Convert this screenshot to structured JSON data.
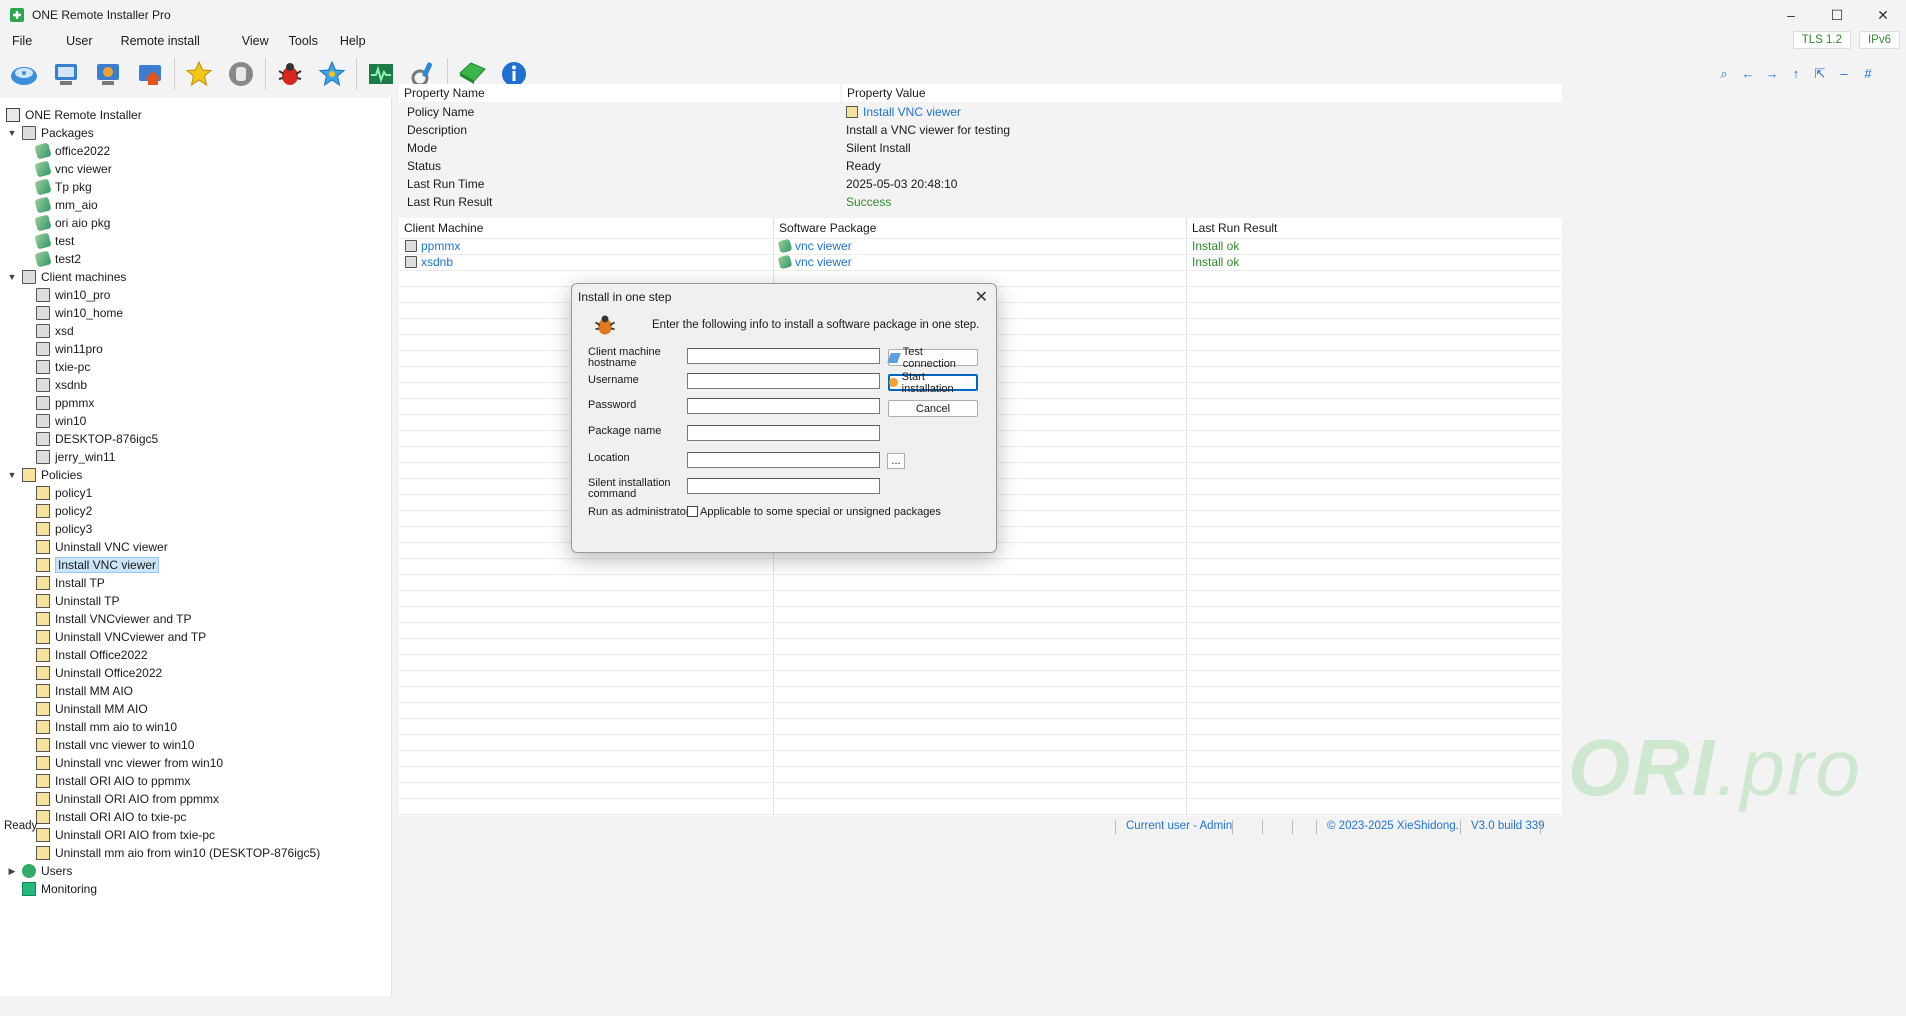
{
  "window": {
    "title": "ONE Remote Installer Pro",
    "min": "–",
    "max": "☐",
    "close": "✕"
  },
  "menu": [
    "File",
    "User",
    "Remote install",
    "View",
    "Tools",
    "Help"
  ],
  "badges": {
    "tls": "TLS 1.2",
    "ip": "IPv6"
  },
  "right_tools": [
    "⌕",
    "←",
    "→",
    "↑",
    "⇱",
    "–",
    "#"
  ],
  "tree": {
    "root": "ONE Remote Installer",
    "packages_label": "Packages",
    "packages": [
      "office2022",
      "vnc viewer",
      "Tp pkg",
      "mm_aio",
      "ori aio pkg",
      "test",
      "test2"
    ],
    "clients_label": "Client machines",
    "clients": [
      "win10_pro",
      "win10_home",
      "xsd",
      "win11pro",
      "txie-pc",
      "xsdnb",
      "ppmmx",
      "win10",
      "DESKTOP-876igc5",
      "jerry_win11"
    ],
    "policies_label": "Policies",
    "policies": [
      "policy1",
      "policy2",
      "policy3",
      "Uninstall VNC viewer",
      "Install VNC viewer",
      "Install TP",
      "Uninstall TP",
      "Install VNCviewer and TP",
      "Uninstall VNCviewer and TP",
      "Install Office2022",
      "Uninstall Office2022",
      "Install MM AIO",
      "Uninstall MM AIO",
      "Install mm aio to win10",
      "Install vnc viewer to win10",
      "Uninstall vnc viewer from win10",
      "Install ORI AIO to ppmmx",
      "Uninstall ORI AIO from ppmmx",
      "Install ORI AIO to txie-pc",
      "Uninstall ORI AIO from txie-pc",
      "Uninstall mm aio from win10 (DESKTOP-876igc5)"
    ],
    "selected_policy": "Install VNC viewer",
    "users_label": "Users",
    "monitoring_label": "Monitoring"
  },
  "properties": {
    "header_name": "Property Name",
    "header_value": "Property Value",
    "rows": [
      {
        "name": "Policy Name",
        "value": "Install VNC viewer"
      },
      {
        "name": "Description",
        "value": "Install a VNC viewer for testing"
      },
      {
        "name": "Mode",
        "value": "Silent Install"
      },
      {
        "name": "Status",
        "value": "Ready"
      },
      {
        "name": "Last Run Time",
        "value": "2025-05-03 20:48:10"
      },
      {
        "name": "Last Run Result",
        "value": "Success"
      }
    ]
  },
  "clients_table": {
    "headers": [
      "Client Machine",
      "Software Package",
      "Last Run Result"
    ],
    "rows": [
      {
        "machine": "ppmmx",
        "package": "vnc viewer",
        "result": "Install ok"
      },
      {
        "machine": "xsdnb",
        "package": "vnc viewer",
        "result": "Install ok"
      }
    ]
  },
  "watermark": {
    "ori": "ORI",
    "pro": ".pro"
  },
  "status": {
    "left": "Ready",
    "user": "Current user - Admin",
    "copyright": "© 2023-2025 XieShidong.",
    "version": "V3.0 build 339"
  },
  "dialog": {
    "title": "Install in one step",
    "close": "✕",
    "intro": "Enter the following info to install a software package in one step.",
    "hostname_label_1": "Client machine",
    "hostname_label_2": "hostname",
    "username_label": "Username",
    "password_label": "Password",
    "package_label": "Package name",
    "location_label": "Location",
    "silent_label_1": "Silent installation",
    "silent_label_2": "command",
    "admin_label": "Run as administrator",
    "admin_checkbox": "Applicable to some special or unsigned packages",
    "test_btn": "Test connection",
    "start_btn": "Start installation",
    "cancel_btn": "Cancel",
    "browse_btn": "..."
  }
}
